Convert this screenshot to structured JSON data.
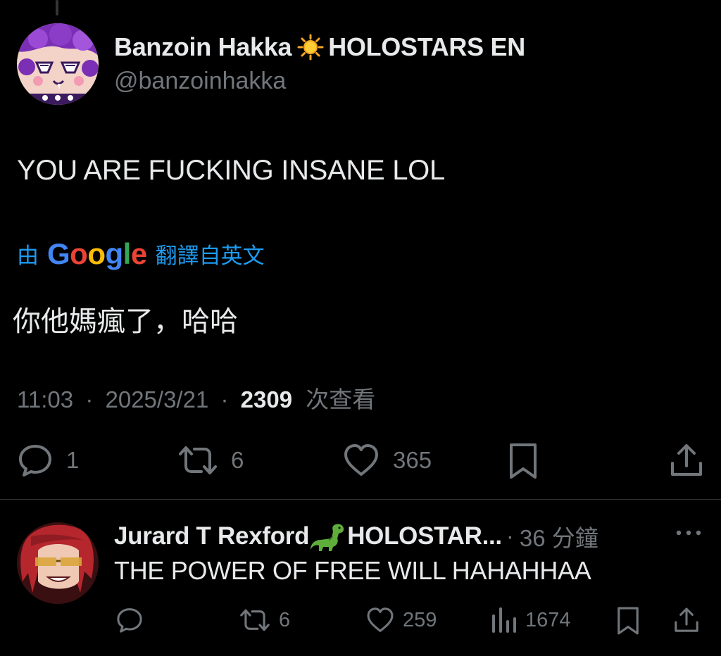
{
  "tweet": {
    "display_name": "Banzoin Hakka",
    "name_suffix": "HOLOSTARS EN",
    "handle": "@banzoinhakka",
    "text": "YOU ARE FUCKING INSANE LOL",
    "translation": {
      "by_label": "由",
      "google_letters": [
        "G",
        "o",
        "o",
        "g",
        "l",
        "e"
      ],
      "google_colors": [
        "#4285F4",
        "#EA4335",
        "#FBBC05",
        "#4285F4",
        "#34A853",
        "#EA4335"
      ],
      "from_label": "翻譯自英文",
      "translated_text": "你他媽瘋了，哈哈"
    },
    "time": "11:03",
    "date": "2025/3/21",
    "views": "2309",
    "views_label": "次查看",
    "separator": "·",
    "stats": {
      "replies": "1",
      "reposts": "6",
      "likes": "365"
    }
  },
  "reply": {
    "display_name": "Jurard T Rexford",
    "name_suffix": "HOLOSTAR...",
    "separator": "·",
    "time_ago": "36 分鐘",
    "text": "THE POWER OF FREE WILL HAHAHHAA",
    "stats": {
      "reposts": "6",
      "likes": "259",
      "views": "1674"
    }
  },
  "icons": {
    "reply": "speech-bubble-icon",
    "repost": "repost-arrows-icon",
    "like": "heart-icon",
    "bookmark": "bookmark-icon",
    "share": "share-upload-icon",
    "views": "bar-chart-icon",
    "more": "more-dots-icon",
    "name_emoji_1": "sun-emoji",
    "name_emoji_2": "dinosaur-emoji"
  },
  "colors": {
    "background": "#000000",
    "text_primary": "#e7e9ea",
    "text_secondary": "#71767b",
    "link_blue": "#1d9bf0",
    "divider": "#2f3336"
  }
}
